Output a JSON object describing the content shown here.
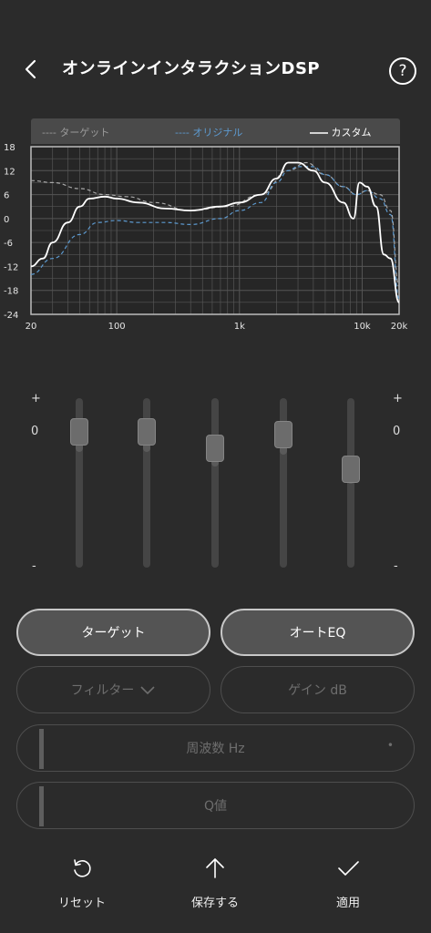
{
  "header": {
    "title": "オンラインインタラクションDSP",
    "help_label": "?"
  },
  "legend": {
    "target": "---- ターゲット",
    "original": "---- オリジナル",
    "custom": "カスタム"
  },
  "chart_data": {
    "type": "line",
    "xscale": "log",
    "xlim": [
      20,
      20000
    ],
    "ylim": [
      -24,
      18
    ],
    "grid": true,
    "xticks": [
      "20",
      "100",
      "1k",
      "10k",
      "20k"
    ],
    "yticks": [
      "18",
      "12",
      "6",
      "0",
      "-6",
      "-12",
      "-18",
      "-24"
    ],
    "series": [
      {
        "name": "ターゲット",
        "color": "#a8a8a8",
        "style": "dashed",
        "x": [
          20,
          30,
          50,
          80,
          120,
          200,
          400,
          800,
          1500,
          2500,
          3500,
          5000,
          7000,
          9000,
          11000,
          14000,
          17000,
          20000
        ],
        "y": [
          9.5,
          9,
          7.5,
          6,
          5.5,
          4,
          2,
          3,
          6,
          12,
          14,
          11,
          8,
          6,
          7,
          6,
          2,
          -17
        ]
      },
      {
        "name": "オリジナル",
        "color": "#5d9ad0",
        "style": "dashed",
        "x": [
          20,
          30,
          50,
          70,
          100,
          150,
          250,
          400,
          700,
          1000,
          1500,
          2000,
          2500,
          3000,
          4000,
          5000,
          7000,
          9000,
          11000,
          14000,
          17000,
          20000
        ],
        "y": [
          -14,
          -10,
          -4,
          -1,
          -0.5,
          -1,
          -1,
          -1.5,
          0,
          2,
          4,
          9,
          12,
          13,
          13,
          11,
          8,
          6,
          7,
          5,
          1,
          -20
        ]
      },
      {
        "name": "カスタム",
        "color": "#ffffff",
        "style": "solid",
        "x": [
          20,
          25,
          30,
          40,
          50,
          60,
          80,
          100,
          150,
          250,
          400,
          700,
          1000,
          1500,
          2000,
          2500,
          3000,
          4000,
          5000,
          7000,
          8500,
          9500,
          11000,
          13000,
          15000,
          17000,
          20000
        ],
        "y": [
          -12,
          -10,
          -6,
          -1,
          3,
          5,
          5.5,
          5,
          4,
          2.5,
          2,
          3,
          4,
          6,
          10,
          14,
          14,
          12,
          9,
          4,
          0,
          9,
          8,
          3,
          -9,
          -10,
          -21
        ]
      }
    ]
  },
  "eq": {
    "plus_label": "+",
    "zero_label": "0",
    "minus_label": "-",
    "bands": [
      0.9,
      0.9,
      0.8,
      0.88,
      0.68
    ]
  },
  "buttons": {
    "target": "ターゲット",
    "auto_eq": "オートEQ",
    "filter": "フィルター",
    "gain": "ゲイン  dB",
    "frequency": "周波数  Hz",
    "frequency_dot": "•",
    "q": "Q値"
  },
  "toolbar": {
    "reset": "リセット",
    "save": "保存する",
    "apply": "適用"
  }
}
